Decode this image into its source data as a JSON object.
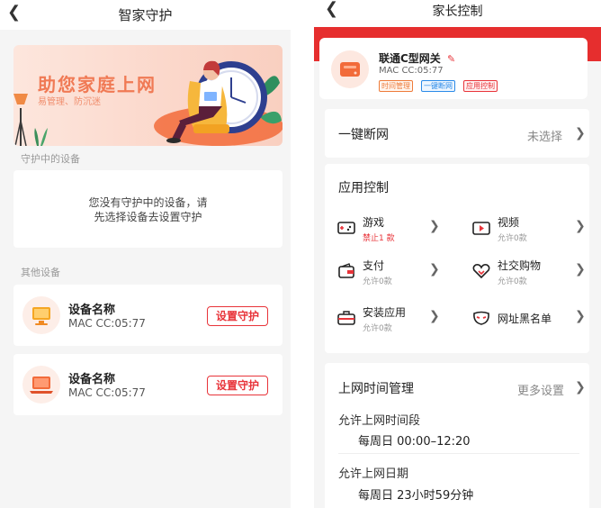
{
  "left": {
    "title": "智家守护",
    "banner": {
      "title": "助您家庭上网",
      "subtitle": "易管理、防沉迷"
    },
    "protected_label": "守护中的设备",
    "empty_text_line1": "您没有守护中的设备，请",
    "empty_text_line2": "先选择设备去设置守护",
    "other_label": "其他设备",
    "devices": [
      {
        "name": "设备名称",
        "mac": "MAC CC:05:77",
        "button": "设置守护",
        "icon": "monitor-icon"
      },
      {
        "name": "设备名称",
        "mac": "MAC CC:05:77",
        "button": "设置守护",
        "icon": "laptop-icon"
      }
    ]
  },
  "right": {
    "title": "家长控制",
    "gateway": {
      "name": "联通C型网关",
      "mac": "MAC CC:05:77",
      "tags": [
        "时间管理",
        "一键断网",
        "应用控制"
      ],
      "icon": "router-icon"
    },
    "disconnect": {
      "label": "一键断网",
      "value": "未选择"
    },
    "app_control": {
      "title": "应用控制",
      "items": [
        {
          "name": "游戏",
          "sub": "禁止1 款",
          "icon": "game-icon"
        },
        {
          "name": "视频",
          "sub": "允许0款",
          "icon": "video-icon"
        },
        {
          "name": "支付",
          "sub": "允许0款",
          "icon": "wallet-icon"
        },
        {
          "name": "社交购物",
          "sub": "允许0款",
          "icon": "heart-icon"
        },
        {
          "name": "安装应用",
          "sub": "允许0款",
          "icon": "toolbox-icon"
        },
        {
          "name": "网址黑名单",
          "sub": "",
          "icon": "mask-icon"
        }
      ]
    },
    "time_mgmt": {
      "title": "上网时间管理",
      "more": "更多设置",
      "period_label": "允许上网时间段",
      "period_value": "每周日  00:00–12:20",
      "date_label": "允许上网日期",
      "date_value": "每周日 23小时59分钟"
    }
  },
  "colors": {
    "accent": "#e8343a",
    "banner_text": "#f07a55",
    "orange": "#ee7b3a",
    "blue": "#2a8ae8"
  }
}
